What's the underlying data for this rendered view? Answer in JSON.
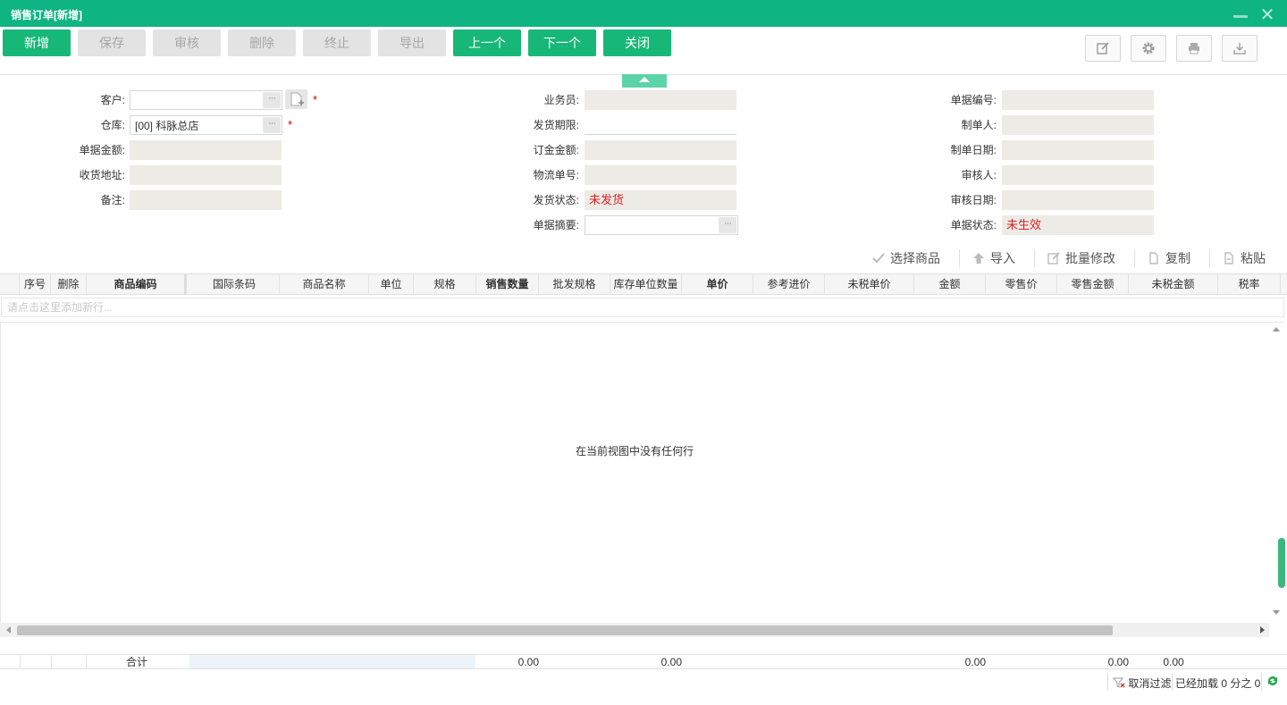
{
  "window": {
    "title": "销售订单[新增]"
  },
  "toolbar": {
    "buttons": [
      {
        "label": "新增",
        "enabled": true
      },
      {
        "label": "保存",
        "enabled": false
      },
      {
        "label": "审核",
        "enabled": false
      },
      {
        "label": "删除",
        "enabled": false
      },
      {
        "label": "终止",
        "enabled": false
      },
      {
        "label": "导出",
        "enabled": false
      },
      {
        "label": "上一个",
        "enabled": true
      },
      {
        "label": "下一个",
        "enabled": true
      },
      {
        "label": "关闭",
        "enabled": true
      }
    ],
    "right_icons": [
      "edit-icon",
      "gear-icon",
      "printer-icon",
      "download-icon"
    ]
  },
  "form": {
    "left": [
      {
        "label": "客户:",
        "value": ""
      },
      {
        "label": "仓库:",
        "value": "[00] 科脉总店"
      },
      {
        "label": "单据金额:",
        "value": ""
      },
      {
        "label": "收货地址:",
        "value": ""
      },
      {
        "label": "备注:",
        "value": ""
      }
    ],
    "middle": [
      {
        "label": "业务员:",
        "value": ""
      },
      {
        "label": "发货期限:",
        "value": ""
      },
      {
        "label": "订金金额:",
        "value": ""
      },
      {
        "label": "物流单号:",
        "value": ""
      },
      {
        "label": "发货状态:",
        "value": "未发货"
      },
      {
        "label": "单据摘要:",
        "value": ""
      }
    ],
    "right": [
      {
        "label": "单据编号:",
        "value": ""
      },
      {
        "label": "制单人:",
        "value": ""
      },
      {
        "label": "制单日期:",
        "value": ""
      },
      {
        "label": "审核人:",
        "value": ""
      },
      {
        "label": "审核日期:",
        "value": ""
      },
      {
        "label": "单据状态:",
        "value": "未生效"
      }
    ],
    "required_mark": "*",
    "ellipsis": "···"
  },
  "grid_toolbar": {
    "select_goods": "选择商品",
    "import": "导入",
    "batch_edit": "批量修改",
    "copy": "复制",
    "paste": "粘贴"
  },
  "grid": {
    "columns": [
      "序号",
      "删除",
      "商品编码",
      "国际条码",
      "商品名称",
      "单位",
      "规格",
      "销售数量",
      "批发规格",
      "库存单位数量",
      "单价",
      "参考进价",
      "未税单价",
      "金额",
      "零售价",
      "零售金额",
      "未税金额",
      "税率"
    ],
    "new_row_hint": "请点击这里添加新行...",
    "empty_message": "在当前视图中没有任何行"
  },
  "totals": {
    "label": "合计",
    "sales_qty": "0.00",
    "stock_unit_qty": "0.00",
    "amount": "0.00",
    "retail_amount": "0.00",
    "untaxed_amount": "0.00"
  },
  "statusbar": {
    "cancel_filter": "取消过滤",
    "loaded": "已经加载 0 分之 0"
  }
}
